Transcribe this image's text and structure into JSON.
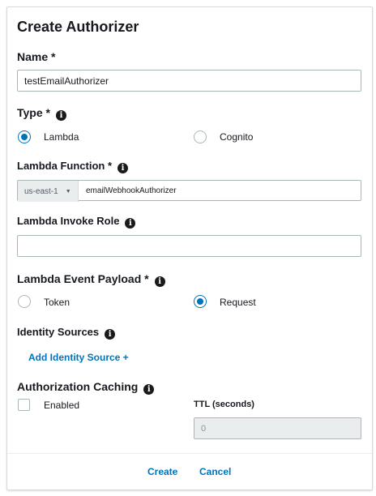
{
  "title": "Create Authorizer",
  "name": {
    "label": "Name *",
    "value": "testEmailAuthorizer"
  },
  "type": {
    "label": "Type *",
    "options": [
      {
        "label": "Lambda",
        "selected": true
      },
      {
        "label": "Cognito",
        "selected": false
      }
    ]
  },
  "lambda_function": {
    "label": "Lambda Function *",
    "region": "us-east-1",
    "value": "emailWebhookAuthorizer"
  },
  "lambda_invoke_role": {
    "label": "Lambda Invoke Role",
    "value": ""
  },
  "event_payload": {
    "label": "Lambda Event Payload *",
    "options": [
      {
        "label": "Token",
        "selected": false
      },
      {
        "label": "Request",
        "selected": true
      }
    ]
  },
  "identity_sources": {
    "label": "Identity Sources",
    "add_link": "Add Identity Source +"
  },
  "caching": {
    "label": "Authorization Caching",
    "enabled_label": "Enabled",
    "enabled": false,
    "ttl_label": "TTL (seconds)",
    "ttl_placeholder": "0"
  },
  "footer": {
    "create": "Create",
    "cancel": "Cancel"
  },
  "icons": {
    "info": "info-icon",
    "caret": "caret-down-icon"
  },
  "colors": {
    "accent": "#0073bb",
    "border": "#aab7b8",
    "text": "#16191f"
  }
}
